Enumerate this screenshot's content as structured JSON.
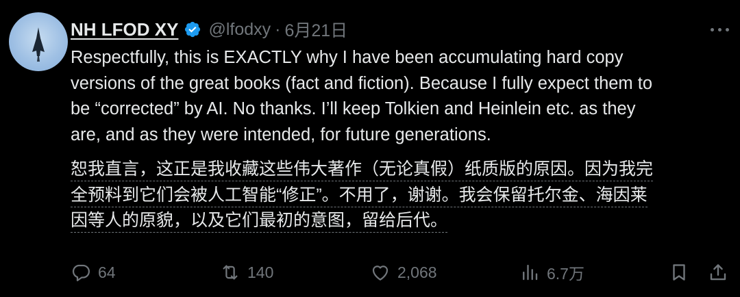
{
  "author": {
    "name": "NH LFOD XY",
    "handle": "@lfodxy",
    "separator": "·",
    "date": "6月21日"
  },
  "tweet": {
    "lines": [
      "Respectfully, this is EXACTLY why I have been accumulating hard copy",
      "versions of the great books (fact and fiction). Because I fully expect them to",
      "be “corrected” by AI. No thanks. I’ll keep Tolkien and Heinlein etc. as they",
      "are, and as they were intended, for future generations."
    ]
  },
  "translation": {
    "lines": [
      "恕我直言，这正是我收藏这些伟大著作（无论真假）纸质版的原因。因为我完",
      "全预料到它们会被人工智能“修正”。不用了，谢谢。我会保留托尔金、海因莱",
      "因等人的原貌，以及它们最初的意图，留给后代。"
    ]
  },
  "actions": {
    "replies": "64",
    "reposts": "140",
    "likes": "2,068",
    "views": "6.7万"
  },
  "icons": {
    "verified": "verified-badge-icon",
    "more": "more-icon",
    "reply": "reply-icon",
    "repost": "repost-icon",
    "like": "heart-icon",
    "views": "views-icon",
    "bookmark": "bookmark-icon",
    "share": "share-icon"
  },
  "colors": {
    "background": "#000000",
    "text": "#e7e9ea",
    "secondary": "#71767b",
    "verified": "#1d9bf0"
  }
}
